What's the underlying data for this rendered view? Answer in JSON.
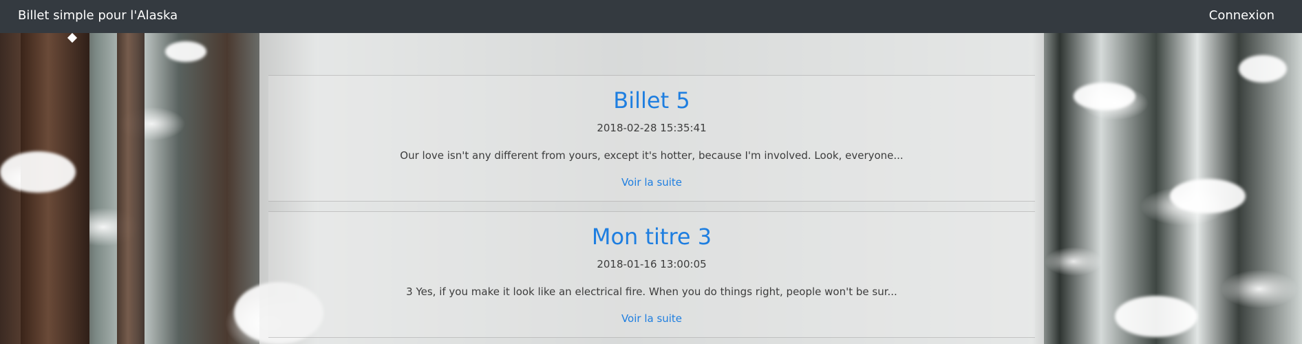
{
  "navbar": {
    "brand": "Billet simple pour l'Alaska",
    "login": "Connexion"
  },
  "posts": [
    {
      "title": "Billet 5",
      "date": "2018-02-28 15:35:41",
      "excerpt": "Our love isn't any different from yours, except it's hotter, because I'm involved. Look, everyone...",
      "link": "Voir la suite"
    },
    {
      "title": "Mon titre 3",
      "date": "2018-01-16 13:00:05",
      "excerpt": "3 Yes, if you make it look like an electrical fire. When you do things right, people won't be sur...",
      "link": "Voir la suite"
    }
  ],
  "colors": {
    "navbar_bg": "#343a40",
    "link": "#1e7ee0",
    "text": "#3c3c3c"
  }
}
